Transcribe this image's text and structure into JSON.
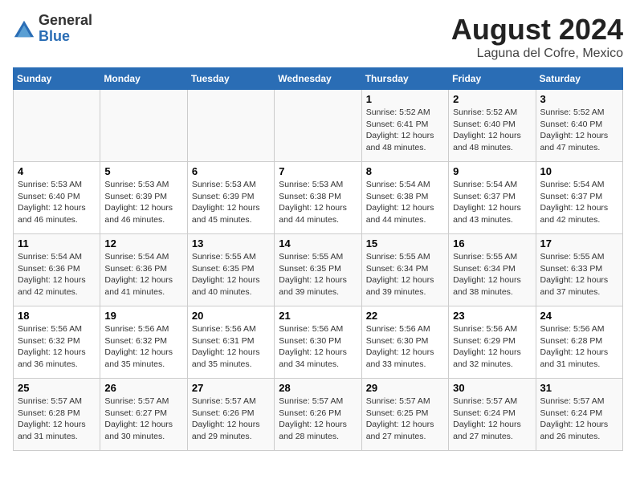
{
  "logo": {
    "general": "General",
    "blue": "Blue"
  },
  "title": "August 2024",
  "subtitle": "Laguna del Cofre, Mexico",
  "days_of_week": [
    "Sunday",
    "Monday",
    "Tuesday",
    "Wednesday",
    "Thursday",
    "Friday",
    "Saturday"
  ],
  "weeks": [
    {
      "days": [
        {
          "num": "",
          "info": ""
        },
        {
          "num": "",
          "info": ""
        },
        {
          "num": "",
          "info": ""
        },
        {
          "num": "",
          "info": ""
        },
        {
          "num": "1",
          "info": "Sunrise: 5:52 AM\nSunset: 6:41 PM\nDaylight: 12 hours\nand 48 minutes."
        },
        {
          "num": "2",
          "info": "Sunrise: 5:52 AM\nSunset: 6:40 PM\nDaylight: 12 hours\nand 48 minutes."
        },
        {
          "num": "3",
          "info": "Sunrise: 5:52 AM\nSunset: 6:40 PM\nDaylight: 12 hours\nand 47 minutes."
        }
      ]
    },
    {
      "days": [
        {
          "num": "4",
          "info": "Sunrise: 5:53 AM\nSunset: 6:40 PM\nDaylight: 12 hours\nand 46 minutes."
        },
        {
          "num": "5",
          "info": "Sunrise: 5:53 AM\nSunset: 6:39 PM\nDaylight: 12 hours\nand 46 minutes."
        },
        {
          "num": "6",
          "info": "Sunrise: 5:53 AM\nSunset: 6:39 PM\nDaylight: 12 hours\nand 45 minutes."
        },
        {
          "num": "7",
          "info": "Sunrise: 5:53 AM\nSunset: 6:38 PM\nDaylight: 12 hours\nand 44 minutes."
        },
        {
          "num": "8",
          "info": "Sunrise: 5:54 AM\nSunset: 6:38 PM\nDaylight: 12 hours\nand 44 minutes."
        },
        {
          "num": "9",
          "info": "Sunrise: 5:54 AM\nSunset: 6:37 PM\nDaylight: 12 hours\nand 43 minutes."
        },
        {
          "num": "10",
          "info": "Sunrise: 5:54 AM\nSunset: 6:37 PM\nDaylight: 12 hours\nand 42 minutes."
        }
      ]
    },
    {
      "days": [
        {
          "num": "11",
          "info": "Sunrise: 5:54 AM\nSunset: 6:36 PM\nDaylight: 12 hours\nand 42 minutes."
        },
        {
          "num": "12",
          "info": "Sunrise: 5:54 AM\nSunset: 6:36 PM\nDaylight: 12 hours\nand 41 minutes."
        },
        {
          "num": "13",
          "info": "Sunrise: 5:55 AM\nSunset: 6:35 PM\nDaylight: 12 hours\nand 40 minutes."
        },
        {
          "num": "14",
          "info": "Sunrise: 5:55 AM\nSunset: 6:35 PM\nDaylight: 12 hours\nand 39 minutes."
        },
        {
          "num": "15",
          "info": "Sunrise: 5:55 AM\nSunset: 6:34 PM\nDaylight: 12 hours\nand 39 minutes."
        },
        {
          "num": "16",
          "info": "Sunrise: 5:55 AM\nSunset: 6:34 PM\nDaylight: 12 hours\nand 38 minutes."
        },
        {
          "num": "17",
          "info": "Sunrise: 5:55 AM\nSunset: 6:33 PM\nDaylight: 12 hours\nand 37 minutes."
        }
      ]
    },
    {
      "days": [
        {
          "num": "18",
          "info": "Sunrise: 5:56 AM\nSunset: 6:32 PM\nDaylight: 12 hours\nand 36 minutes."
        },
        {
          "num": "19",
          "info": "Sunrise: 5:56 AM\nSunset: 6:32 PM\nDaylight: 12 hours\nand 35 minutes."
        },
        {
          "num": "20",
          "info": "Sunrise: 5:56 AM\nSunset: 6:31 PM\nDaylight: 12 hours\nand 35 minutes."
        },
        {
          "num": "21",
          "info": "Sunrise: 5:56 AM\nSunset: 6:30 PM\nDaylight: 12 hours\nand 34 minutes."
        },
        {
          "num": "22",
          "info": "Sunrise: 5:56 AM\nSunset: 6:30 PM\nDaylight: 12 hours\nand 33 minutes."
        },
        {
          "num": "23",
          "info": "Sunrise: 5:56 AM\nSunset: 6:29 PM\nDaylight: 12 hours\nand 32 minutes."
        },
        {
          "num": "24",
          "info": "Sunrise: 5:56 AM\nSunset: 6:28 PM\nDaylight: 12 hours\nand 31 minutes."
        }
      ]
    },
    {
      "days": [
        {
          "num": "25",
          "info": "Sunrise: 5:57 AM\nSunset: 6:28 PM\nDaylight: 12 hours\nand 31 minutes."
        },
        {
          "num": "26",
          "info": "Sunrise: 5:57 AM\nSunset: 6:27 PM\nDaylight: 12 hours\nand 30 minutes."
        },
        {
          "num": "27",
          "info": "Sunrise: 5:57 AM\nSunset: 6:26 PM\nDaylight: 12 hours\nand 29 minutes."
        },
        {
          "num": "28",
          "info": "Sunrise: 5:57 AM\nSunset: 6:26 PM\nDaylight: 12 hours\nand 28 minutes."
        },
        {
          "num": "29",
          "info": "Sunrise: 5:57 AM\nSunset: 6:25 PM\nDaylight: 12 hours\nand 27 minutes."
        },
        {
          "num": "30",
          "info": "Sunrise: 5:57 AM\nSunset: 6:24 PM\nDaylight: 12 hours\nand 27 minutes."
        },
        {
          "num": "31",
          "info": "Sunrise: 5:57 AM\nSunset: 6:24 PM\nDaylight: 12 hours\nand 26 minutes."
        }
      ]
    }
  ]
}
